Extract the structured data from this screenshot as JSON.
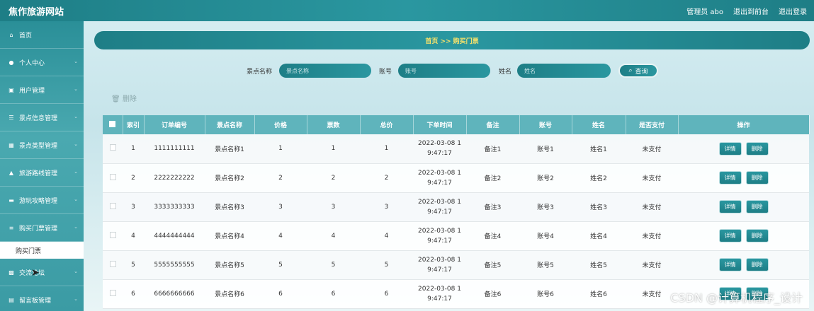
{
  "header": {
    "site_title": "焦作旅游网站",
    "links": [
      "管理员 abo",
      "退出到前台",
      "退出登录"
    ]
  },
  "sidebar": {
    "items": [
      {
        "icon": "home-icon",
        "glyph": "⌂",
        "label": "首页"
      },
      {
        "icon": "user-icon",
        "glyph": "●",
        "label": "个人中心"
      },
      {
        "icon": "users-icon",
        "glyph": "▣",
        "label": "用户管理"
      },
      {
        "icon": "list-icon",
        "glyph": "☰",
        "label": "景点信息管理"
      },
      {
        "icon": "grid-icon",
        "glyph": "▦",
        "label": "景点类型管理"
      },
      {
        "icon": "route-icon",
        "glyph": "▲",
        "label": "旅游路线管理"
      },
      {
        "icon": "book-icon",
        "glyph": "▬",
        "label": "游玩攻略管理"
      },
      {
        "icon": "ticket-icon",
        "glyph": "≡",
        "label": "购买门票管理"
      }
    ],
    "subitem": "购买门票",
    "after_items": [
      {
        "icon": "chat-icon",
        "glyph": "▩",
        "label": "交流论坛"
      },
      {
        "icon": "board-icon",
        "glyph": "▤",
        "label": "留言板管理"
      }
    ]
  },
  "breadcrumb": "首页 >> 购买门票",
  "search": {
    "spot_label": "景点名称",
    "spot_placeholder": "景点名称",
    "account_label": "账号",
    "account_placeholder": "账号",
    "name_label": "姓名",
    "name_placeholder": "姓名",
    "query_label": "查询"
  },
  "batch_delete": "删除",
  "table": {
    "columns": [
      "索引",
      "订单编号",
      "景点名称",
      "价格",
      "票数",
      "总价",
      "下单时间",
      "备注",
      "账号",
      "姓名",
      "是否支付",
      "操作"
    ],
    "rows": [
      {
        "index": "1",
        "order": "1111111111",
        "spot": "景点名称1",
        "price": "1",
        "count": "1",
        "total": "1",
        "time1": "2022-03-08 1",
        "time2": "9:47:17",
        "note": "备注1",
        "account": "账号1",
        "name": "姓名1",
        "paid": "未支付"
      },
      {
        "index": "2",
        "order": "2222222222",
        "spot": "景点名称2",
        "price": "2",
        "count": "2",
        "total": "2",
        "time1": "2022-03-08 1",
        "time2": "9:47:17",
        "note": "备注2",
        "account": "账号2",
        "name": "姓名2",
        "paid": "未支付"
      },
      {
        "index": "3",
        "order": "3333333333",
        "spot": "景点名称3",
        "price": "3",
        "count": "3",
        "total": "3",
        "time1": "2022-03-08 1",
        "time2": "9:47:17",
        "note": "备注3",
        "account": "账号3",
        "name": "姓名3",
        "paid": "未支付"
      },
      {
        "index": "4",
        "order": "4444444444",
        "spot": "景点名称4",
        "price": "4",
        "count": "4",
        "total": "4",
        "time1": "2022-03-08 1",
        "time2": "9:47:17",
        "note": "备注4",
        "account": "账号4",
        "name": "姓名4",
        "paid": "未支付"
      },
      {
        "index": "5",
        "order": "5555555555",
        "spot": "景点名称5",
        "price": "5",
        "count": "5",
        "total": "5",
        "time1": "2022-03-08 1",
        "time2": "9:47:17",
        "note": "备注5",
        "account": "账号5",
        "name": "姓名5",
        "paid": "未支付"
      },
      {
        "index": "6",
        "order": "6666666666",
        "spot": "景点名称6",
        "price": "6",
        "count": "6",
        "total": "6",
        "time1": "2022-03-08 1",
        "time2": "9:47:17",
        "note": "备注6",
        "account": "账号6",
        "name": "姓名6",
        "paid": "未支付"
      }
    ],
    "detail_label": "详情",
    "delete_label": "删除"
  },
  "watermark": "CSDN @计算机程序_设计",
  "colors": {
    "primary": "#2a97a0",
    "primary_dark": "#1e7e86",
    "breadcrumb_text": "#f8e26a",
    "table_header": "#5fb4bc"
  }
}
